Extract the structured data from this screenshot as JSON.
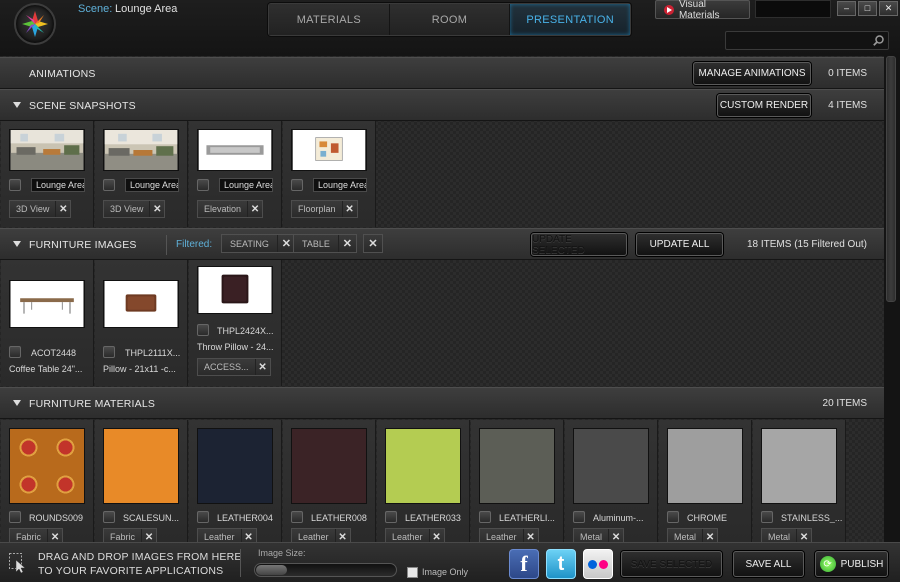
{
  "header": {
    "scene_label": "Scene:",
    "scene_name": "Lounge Area",
    "tabs": [
      "MATERIALS",
      "ROOM",
      "PRESENTATION"
    ],
    "active_tab": 2,
    "visual_materials": "Visual Materials",
    "window_buttons": [
      "–",
      "□",
      "✕"
    ],
    "search_value": ""
  },
  "animations": {
    "title": "ANIMATIONS",
    "button": "MANAGE ANIMATIONS",
    "count": "0 ITEMS"
  },
  "snapshots": {
    "title": "SCENE SNAPSHOTS",
    "button": "CUSTOM RENDER",
    "count": "4 ITEMS",
    "items": [
      {
        "name": "Lounge Area",
        "view": "3D View"
      },
      {
        "name": "Lounge Area",
        "view": "3D View"
      },
      {
        "name": "Lounge Area",
        "view": "Elevation"
      },
      {
        "name": "Lounge Area",
        "view": "Floorplan"
      }
    ]
  },
  "furniture_images": {
    "title": "FURNITURE IMAGES",
    "filtered_label": "Filtered:",
    "filters": [
      "SEATING",
      "TABLE"
    ],
    "btn_update_selected": "UPDATE SELECTED",
    "btn_update_all": "UPDATE ALL",
    "count": "18 ITEMS (15 Filtered Out)",
    "items": [
      {
        "code": "ACOT2448",
        "desc": "Coffee Table 24\"..."
      },
      {
        "code": "THPL2111X...",
        "desc": "Pillow - 21x11 -c..."
      },
      {
        "code": "THPL2424X...",
        "desc": "Throw Pillow - 24...",
        "tag": "ACCESS..."
      }
    ]
  },
  "furniture_materials": {
    "title": "FURNITURE MATERIALS",
    "count": "20 ITEMS",
    "items": [
      {
        "name": "ROUNDS009",
        "cat": "Fabric",
        "color": "#b86a1c"
      },
      {
        "name": "SCALESUN...",
        "cat": "Fabric",
        "color": "#e88a28"
      },
      {
        "name": "LEATHER004",
        "cat": "Leather",
        "color": "#1c2333"
      },
      {
        "name": "LEATHER008",
        "cat": "Leather",
        "color": "#3b2326"
      },
      {
        "name": "LEATHER033",
        "cat": "Leather",
        "color": "#b4cc52"
      },
      {
        "name": "LEATHERLI...",
        "cat": "Leather",
        "color": "#5c5e56"
      },
      {
        "name": "Aluminum-...",
        "cat": "Metal",
        "color": "#4a4a4a"
      },
      {
        "name": "CHROME",
        "cat": "Metal",
        "color": "#9e9e9e"
      },
      {
        "name": "STAINLESS_...",
        "cat": "Metal",
        "color": "#a6a6a6"
      }
    ]
  },
  "bottom": {
    "drag_line1": "DRAG AND DROP IMAGES FROM HERE",
    "drag_line2": "TO YOUR FAVORITE APPLICATIONS",
    "image_size_label": "Image Size:",
    "image_size_value": 0.22,
    "image_only_label": "Image Only",
    "fb": "f",
    "tw": "t",
    "btn_save_selected": "SAVE SELECTED",
    "btn_save_all": "SAVE ALL",
    "btn_publish": "PUBLISH"
  }
}
